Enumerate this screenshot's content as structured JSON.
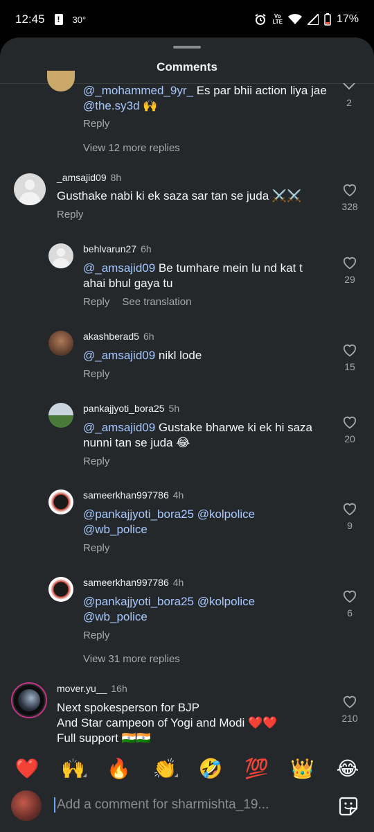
{
  "status": {
    "time": "12:45",
    "alert": "!",
    "temp": "30°",
    "network": "Vo\nLTE",
    "battery": "17%"
  },
  "sheet": {
    "title": "Comments"
  },
  "top_reply": {
    "username": "@_mohammed_9yr_",
    "text": " Es par bhii action liya jae ",
    "mention2": "@the.sy3d",
    "emoji": " 🙌",
    "reply": "Reply",
    "likes": "2",
    "view_more": "View 12 more replies"
  },
  "comments": [
    {
      "username": "_amsajid09",
      "time": "8h",
      "text": "Gusthake nabi ki ek saza sar tan se juda ⚔️⚔️",
      "reply": "Reply",
      "likes": "328"
    },
    {
      "username": "behlvarun27",
      "time": "6h",
      "mention": "@_amsajid09",
      "text": " Be tumhare mein lu nd kat t ahai bhul gaya tu",
      "reply": "Reply",
      "translate": "See translation",
      "likes": "29"
    },
    {
      "username": "akashberad5",
      "time": "6h",
      "mention": "@_amsajid09",
      "text": " nikl lode",
      "reply": "Reply",
      "likes": "15"
    },
    {
      "username": "pankajjyoti_bora25",
      "time": "5h",
      "mention": "@_amsajid09",
      "text": " Gustake bharwe ki ek hi saza nunni tan se juda 😂",
      "reply": "Reply",
      "likes": "20"
    },
    {
      "username": "sameerkhan997786",
      "time": "4h",
      "mention": "@pankajjyoti_bora25 @kolpolice @wb_police",
      "reply": "Reply",
      "likes": "9"
    },
    {
      "username": "sameerkhan997786",
      "time": "4h",
      "mention": "@pankajjyoti_bora25 @kolpolice @wb_police",
      "reply": "Reply",
      "likes": "6"
    },
    {
      "username": "mover.yu__",
      "time": "16h",
      "line1": "Next spokesperson for BJP",
      "line2": "And Star campeon of Yogi and Modi ❤️❤️",
      "line3": "Full support 🇮🇳🇮🇳",
      "likes": "210"
    }
  ],
  "view_more_2": "View 31 more replies",
  "emojis": [
    "❤️",
    "🙌",
    "🔥",
    "👏",
    "🤣",
    "💯",
    "👑",
    "😂"
  ],
  "compose": {
    "placeholder": "Add a comment for sharmishta_19..."
  },
  "colors": {
    "sheet_bg": "#25282b",
    "mention": "#a6c8ff",
    "muted": "#a8a8a8"
  }
}
